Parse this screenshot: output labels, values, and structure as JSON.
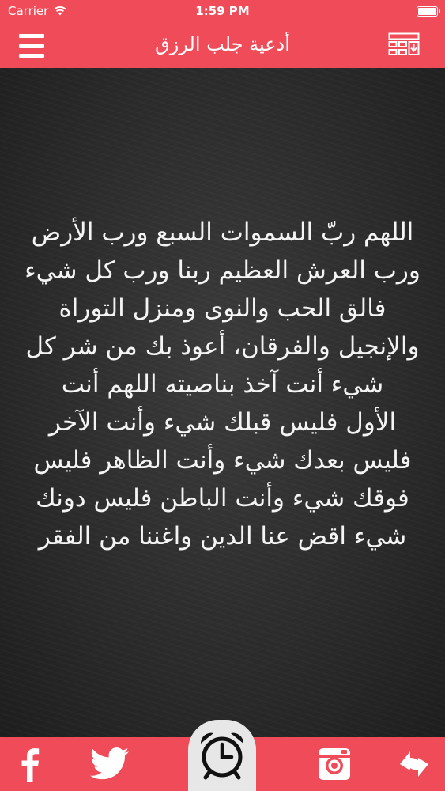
{
  "status_bar": {
    "carrier": "Carrier",
    "time": "1:59 PM"
  },
  "nav": {
    "title": "أدعية جلب الرزق",
    "menu_icon": "hamburger-menu-icon",
    "right_icon": "grid-download-icon"
  },
  "content": {
    "dua_text": "اللهم ربّ السموات السبع ورب الأرض\nورب العرش العظيم ربنا ورب كل شيء\nفالق الحب والنوى ومنزل التوراة\nوالإنجيل والفرقان، أعوذ بك من شر كل\nشيء أنت آخذ بناصيته اللهم أنت\nالأول فليس قبلك شيء وأنت الآخر\nفليس بعدك شيء وأنت الظاهر فليس\nفوقك شيء وأنت الباطن فليس دونك\nشيء اقض عنا الدين واغننا من الفقر"
  },
  "toolbar": {
    "icons": [
      "facebook-icon",
      "twitter-icon",
      "alarm-clock-icon",
      "instagram-icon",
      "share-icon"
    ]
  },
  "colors": {
    "accent": "#ef4b58",
    "board": "#2c2c2c",
    "chalk": "#f4f4f4",
    "alarm_tab": "#e7e7e7"
  }
}
